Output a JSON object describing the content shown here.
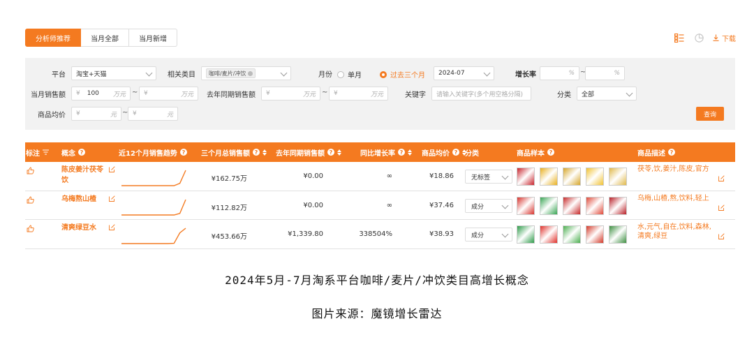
{
  "tabs": [
    {
      "label": "分析师推荐",
      "active": true
    },
    {
      "label": "当月全部",
      "active": false
    },
    {
      "label": "当月新增",
      "active": false
    }
  ],
  "toolbar": {
    "download_label": "下载",
    "icons": [
      "table-view-icon",
      "pie-chart-icon",
      "download-icon"
    ]
  },
  "filters": {
    "platform": {
      "label": "平台",
      "value": "淘宝+天猫"
    },
    "category": {
      "label": "相关类目",
      "tag": "咖啡/麦片/冲饮"
    },
    "month": {
      "label": "月份",
      "options": [
        "单月",
        "过去三个月"
      ],
      "selected": "过去三个月",
      "value": "2024-07"
    },
    "growth": {
      "label": "增长率",
      "unit": "%",
      "tilde": "~"
    },
    "sales": {
      "label": "当月销售额",
      "currency": "¥",
      "min": "100",
      "unit": "万元",
      "tilde": "~"
    },
    "last_year_sales": {
      "label": "去年同期销售额",
      "currency": "¥",
      "unit": "万元",
      "tilde": "~"
    },
    "keyword": {
      "label": "关键字",
      "placeholder": "请输入关键字(多个用空格分隔)"
    },
    "classify": {
      "label": "分类",
      "value": "全部"
    },
    "avg_price": {
      "label": "商品均价",
      "currency": "¥",
      "unit": "元",
      "tilde": "~"
    },
    "query_label": "查询"
  },
  "table": {
    "headers": [
      "标注",
      "概念",
      "近12个月销售趋势",
      "三个月总销售额",
      "去年同期销售额",
      "同比增长率",
      "商品均价",
      "分类",
      "商品样本",
      "商品描述"
    ],
    "rows": [
      {
        "concept": "陈皮姜汁茯苓饮",
        "total": "¥162.75万",
        "last_year": "¥0.00",
        "growth": "∞",
        "avg": "¥18.86",
        "category": "无标签",
        "desc": "茯苓,饮,姜汁,陈皮,官方",
        "trend": [
          0,
          0,
          0,
          0,
          0,
          0,
          0,
          0,
          0,
          0,
          0.15,
          1
        ],
        "samples": [
          "#c8232c",
          "#e8b020",
          "#d6a62a",
          "#f1c232",
          "#e0b84a"
        ]
      },
      {
        "concept": "乌梅熬山楂",
        "total": "¥112.82万",
        "last_year": "¥0.00",
        "growth": "∞",
        "avg": "¥37.46",
        "category": "成分",
        "desc": "乌梅,山楂,熬,饮料,轻上",
        "trend": [
          0,
          0,
          0,
          0,
          0,
          0,
          0,
          0,
          0,
          0,
          0.1,
          1
        ],
        "samples": [
          "#d8342e",
          "#3aa655",
          "#c72a2a",
          "#e04a3a",
          "#b81f27"
        ]
      },
      {
        "concept": "清爽绿豆水",
        "total": "¥453.66万",
        "last_year": "¥1,339.80",
        "growth": "338504%",
        "avg": "¥38.93",
        "category": "成分",
        "desc": "水,元气,自在,饮料,森林,清爽,绿豆",
        "trend": [
          0,
          0,
          0,
          0,
          0,
          0,
          0,
          0,
          0,
          0.02,
          0.7,
          1
        ],
        "samples": [
          "#2e9c4a",
          "#e0302a",
          "#4caf50",
          "#d43a2a",
          "#3d8f40"
        ]
      }
    ]
  },
  "caption": {
    "title": "2024年5月-7月淘系平台咖啡/麦片/冲饮类目高增长概念",
    "source": "图片来源：魔镜增长雷达"
  },
  "colors": {
    "accent": "#f47a20",
    "panel": "#f2f2f2"
  }
}
